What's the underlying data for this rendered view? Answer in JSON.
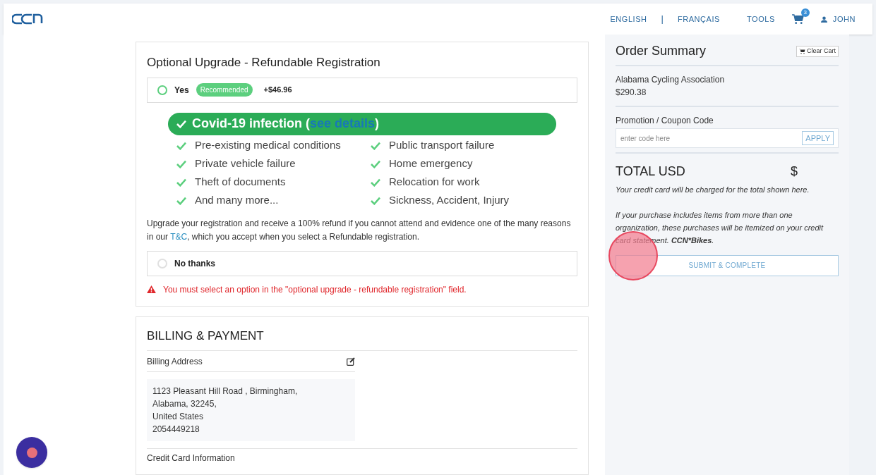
{
  "nav": {
    "links": [
      "ENGLISH",
      "FRANÇAIS",
      "TOOLS"
    ],
    "separator": "|",
    "cart_count": "3",
    "user": "JOHN"
  },
  "upgrade": {
    "title": "Optional Upgrade - Refundable Registration",
    "options": [
      {
        "label": "Yes",
        "badge": "Recommended",
        "price": "+$46.96",
        "selected": false
      },
      {
        "label": "No thanks",
        "selected": false
      }
    ],
    "highlight": {
      "text": "Covid-19 infection (",
      "link": "see details",
      "end": ")"
    },
    "reasons": [
      "Pre-existing medical conditions",
      "Public transport failure",
      "Private vehicle failure",
      "Home emergency",
      "Theft of documents",
      "Relocation for work",
      "And many more...",
      "Sickness, Accident, Injury"
    ],
    "description": {
      "before": "Upgrade your registration and receive a 100% refund if you cannot attend and evidence one of the many reasons in our",
      "link": "T&C",
      "after": ", which you accept when you select a Refundable registration."
    },
    "error": "You must select an option in the \"optional upgrade - refundable registration\" field."
  },
  "billing": {
    "title": "BILLING & PAYMENT",
    "address_label": "Billing Address",
    "address_lines": [
      "1123 Pleasant Hill Road , Birmingham,",
      "Alabama, 32245,",
      "United States",
      "2054449218"
    ],
    "next_section": "Credit Card Information"
  },
  "summary": {
    "title": "Order Summary",
    "clear_cart": "Clear Cart",
    "items": [
      {
        "name": "Alabama Cycling Association",
        "price": "$290.38"
      }
    ],
    "coupon_label": "Promotion / Coupon Code",
    "coupon_placeholder": "enter code here",
    "apply": "APPLY",
    "total_label": "TOTAL USD",
    "total_amount": "$",
    "charge_note": "Your credit card will be charged for the total shown here.",
    "statement_note": "If your purchase includes items from more than one organization, these purchases will be itemized on your credit card statement. **CCN*Bikes**.",
    "submit": "SUBMIT & COMPLETE"
  }
}
